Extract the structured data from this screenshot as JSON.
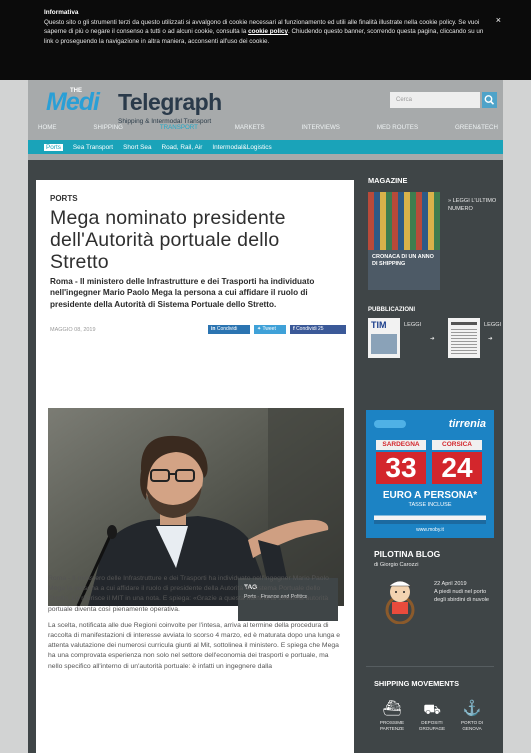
{
  "cookie": {
    "title": "Informativa",
    "text_before_link": "Questo sito o gli strumenti terzi da questo utilizzati si avvalgono di cookie necessari al funzionamento ed utili alle finalità illustrate nella cookie policy. Se vuoi saperne di più o negare il consenso a tutti o ad alcuni cookie, consulta la",
    "link": "cookie policy",
    "text_after_link": ". Chiudendo questo banner, scorrendo questa pagina, cliccando su un link o proseguendo la navigazione in altra maniera, acconsenti all'uso dei cookie.",
    "close": "×"
  },
  "logo": {
    "the": "THE",
    "medi": "Medi",
    "telegraph": "Telegraph",
    "tagline": "Shipping & Intermodal Transport",
    "colors": {
      "medi": "#2a9fd6",
      "telegraph": "#2a3a4a"
    }
  },
  "search": {
    "placeholder": "Cerca",
    "icon": "search-icon"
  },
  "nav": [
    "HOME",
    "SHIPPING",
    "TRANSPORT",
    "MARKETS",
    "INTERVIEWS",
    "MED ROUTES",
    "GREEN&TECH"
  ],
  "nav_active": "TRANSPORT",
  "subnav": [
    "Ports",
    "Sea Transport",
    "Short Sea",
    "Road, Rail, Air",
    "Intermodal&Logistics"
  ],
  "subnav_selected": "Ports",
  "article": {
    "kicker": "PORTS",
    "title": "Mega nominato presidente dell'Autorità portuale dello Stretto",
    "lead": "Roma - Il ministero delle Infrastrutture e dei Trasporti ha individuato nell'ingegner Mario Paolo Mega la persona a cui affidare il ruolo di presidente della Autorità di Sistema Portuale dello Stretto.",
    "date": "MAGGIO 08, 2019",
    "share_buttons": [
      {
        "label": "Condividi",
        "color": "#2b74b1",
        "icon": "linkedin-icon"
      },
      {
        "label": "Tweet",
        "color": "#3fa1d8",
        "icon": "twitter-icon"
      },
      {
        "label": "Condividi 25",
        "color": "#3b5998",
        "icon": "facebook-icon"
      }
    ],
    "body_1": "Roma - Il ministero delle Infrastrutture e dei Trasporti ha individuato nell'ingegner Mario Paolo Mega la persona a cui affidare il ruolo di presidente della Autorità di Sistema Portuale dello Stretto. Lo riferisce il MIT in una nota. E spiega: «Grazie a questa nomina la 16esima autorità portuale diventa così pienamente operativa.",
    "body_2": "La scelta, notificata alle due Regioni coinvolte per l'intesa, arriva al termine della procedura di raccolta di manifestazioni di interesse avviata lo scorso 4 marzo, ed è maturata dopo una lunga e attenta valutazione dei numerosi curricula giunti al Mit, sottolinea il ministero. E spiega che Mega ha una comprovata esperienza non solo nel settore dell'economia dei trasporti e portuale, ma nello specifico all'interno di un'autorità portuale: è infatti un ingegnere dalla",
    "tag_label": "TAG",
    "tag_value": "Ports - Finance and Politics"
  },
  "sidebar": {
    "magazine": {
      "title": "MAGAZINE",
      "cover_text": "CRONACA DI UN ANNO DI SHIPPING",
      "read_link": "» LEGGI L'ULTIMO NUMERO"
    },
    "pubblicazioni": {
      "title": "PUBBLICAZIONI",
      "items": [
        {
          "label": "LEGGI",
          "masthead": "TIM"
        },
        {
          "label": "LEGGI",
          "masthead": ""
        }
      ]
    },
    "ad": {
      "brand": "tirrenia",
      "destinations": [
        "SARDEGNA",
        "CORSICA"
      ],
      "price_1": "33",
      "price_2": "24",
      "tagline": "EURO A PERSONA*",
      "subtag": "TASSE INCLUSE",
      "url": "www.moby.it"
    },
    "pilotina": {
      "title": "PILOTINA BLOG",
      "author": "di Giorgio Carozzi",
      "date": "22 April 2019",
      "text": "A piedi nudi nel porto degli sbirdini di nuvole"
    },
    "shipping": {
      "title": "SHIPPING MOVEMENTS",
      "items": [
        {
          "label": "PROSSIME PARTENZE",
          "icon": "ship-icon"
        },
        {
          "label": "DEPOSITI GROUPAGE",
          "icon": "cargo-icon"
        },
        {
          "label": "PORTO DI GENOVA",
          "icon": "anchor-icon"
        }
      ]
    }
  }
}
